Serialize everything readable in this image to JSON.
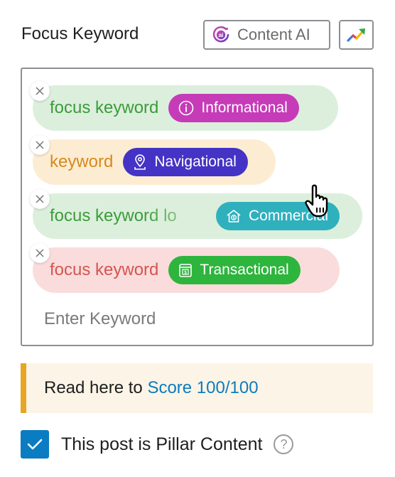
{
  "header": {
    "title": "Focus Keyword",
    "content_ai_label": "Content AI",
    "content_ai_icon": "content-ai-icon",
    "trends_icon": "trend-chart-icon"
  },
  "keywords": [
    {
      "text": "focus keyword",
      "intent": "Informational",
      "intent_icon": "info-icon",
      "chip_color": "#dcefdc",
      "text_color": "#3b9c3b",
      "intent_color": "#c63bb8"
    },
    {
      "text": "keyword",
      "intent": "Navigational",
      "intent_icon": "location-pin-icon",
      "chip_color": "#fcecd2",
      "text_color": "#d68a1e",
      "intent_color": "#4433c4"
    },
    {
      "text": "focus keyword lo",
      "intent": "Commercial",
      "intent_icon": "house-dollar-icon",
      "chip_color": "#dcefdc",
      "text_color": "#3b9c3b",
      "intent_color": "#2fb0bd"
    },
    {
      "text": "focus keyword",
      "intent": "Transactional",
      "intent_icon": "wallet-dollar-icon",
      "chip_color": "#fadcdc",
      "text_color": "#d4554f",
      "intent_color": "#2db53d"
    }
  ],
  "input": {
    "placeholder": "Enter Keyword",
    "value": ""
  },
  "notice": {
    "lead": "Read here to ",
    "link": "Score 100/100",
    "accent_color": "#e8a524"
  },
  "pillar": {
    "label": "This post is Pillar Content",
    "checked": true,
    "help_symbol": "?"
  }
}
